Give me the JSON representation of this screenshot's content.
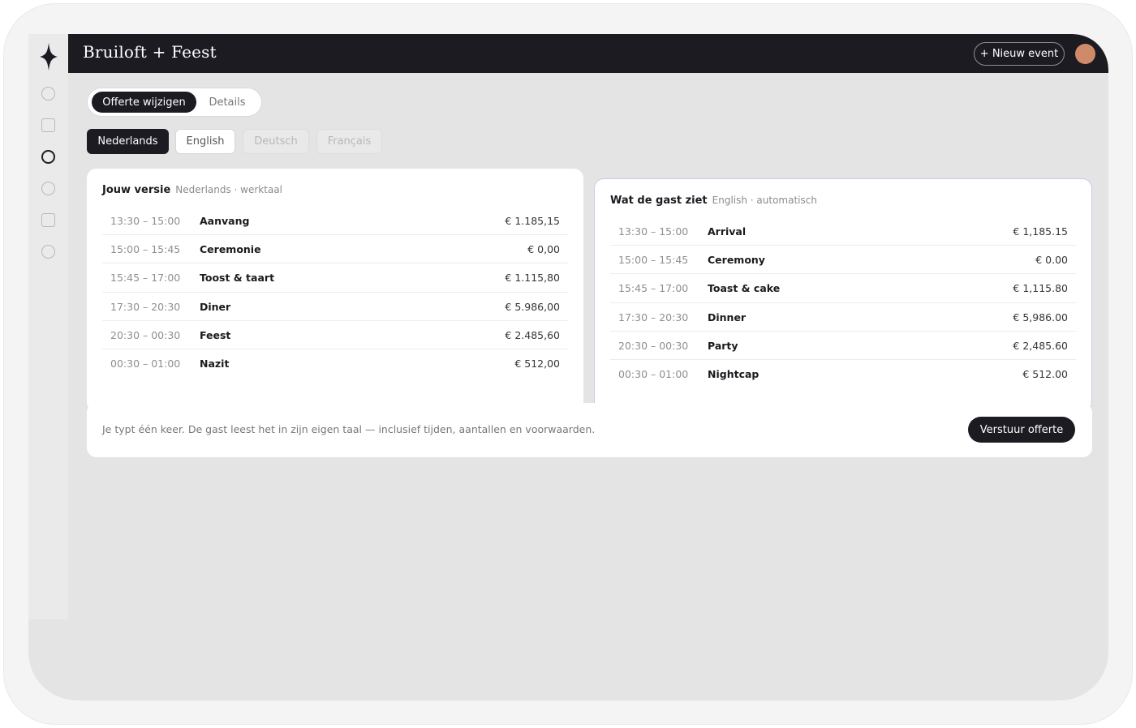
{
  "app": {
    "brand": "Bruiloft + Feest",
    "new_event_label": "+ Nieuw event"
  },
  "icons": {
    "logo": "sparkle-icon",
    "rail": [
      "circle-icon",
      "square-icon",
      "circle-icon",
      "circle-icon",
      "square-icon",
      "circle-icon"
    ]
  },
  "tabs": {
    "active": "Offerte wijzigen",
    "inactive": "Details"
  },
  "languages": [
    {
      "label": "Nederlands",
      "state": "active"
    },
    {
      "label": "English",
      "state": "available"
    },
    {
      "label": "Deutsch",
      "state": "disabled"
    },
    {
      "label": "Français",
      "state": "disabled"
    }
  ],
  "your_version": {
    "title": "Jouw versie",
    "subtitle": "Nederlands · werktaal",
    "rows": [
      {
        "time": "13:30 – 15:00",
        "name": "Aanvang",
        "price": "€ 1.185,15"
      },
      {
        "time": "15:00 – 15:45",
        "name": "Ceremonie",
        "price": "€ 0,00"
      },
      {
        "time": "15:45 – 17:00",
        "name": "Toost & taart",
        "price": "€ 1.115,80"
      },
      {
        "time": "17:30 – 20:30",
        "name": "Diner",
        "price": "€ 5.986,00"
      },
      {
        "time": "20:30 – 00:30",
        "name": "Feest",
        "price": "€ 2.485,60"
      },
      {
        "time": "00:30 – 01:00",
        "name": "Nazit",
        "price": "€ 512,00"
      }
    ]
  },
  "guest_view": {
    "title": "Wat de gast ziet",
    "subtitle": "English · automatisch",
    "rows": [
      {
        "time": "13:30 – 15:00",
        "name": "Arrival",
        "price": "€ 1,185.15"
      },
      {
        "time": "15:00 – 15:45",
        "name": "Ceremony",
        "price": "€ 0.00"
      },
      {
        "time": "15:45 – 17:00",
        "name": "Toast & cake",
        "price": "€ 1,115.80"
      },
      {
        "time": "17:30 – 20:30",
        "name": "Dinner",
        "price": "€ 5,986.00"
      },
      {
        "time": "20:30 – 00:30",
        "name": "Party",
        "price": "€ 2,485.60"
      },
      {
        "time": "00:30 – 01:00",
        "name": "Nightcap",
        "price": "€ 512.00"
      }
    ]
  },
  "footer": {
    "text": "Je typt één keer. De gast leest het in zijn eigen taal — inclusief tijden, aantallen en voorwaarden.",
    "send_label": "Verstuur offerte"
  },
  "colors": {
    "dark": "#1c1b21",
    "avatar": "#cf8b69",
    "guest_card_border": "#c7cde3"
  }
}
